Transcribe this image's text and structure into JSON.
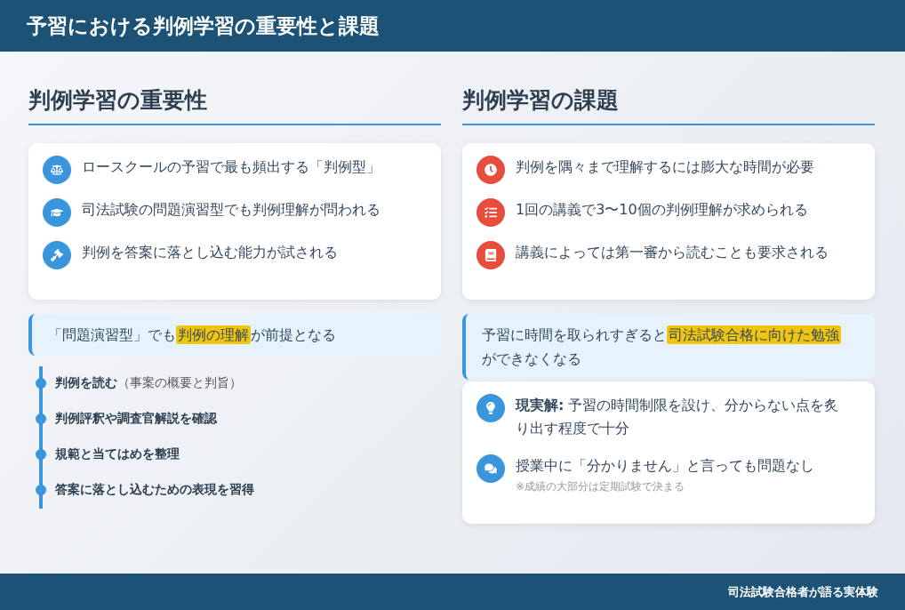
{
  "header": {
    "title": "予習における判例学習の重要性と課題"
  },
  "columns": [
    {
      "kind": "positive",
      "heading": "判例学習の重要性",
      "points": [
        {
          "text": "ロースクールの予習で最も頻出する「判例型」"
        },
        {
          "text": "司法試験の問題演習型でも判例理解が問われる"
        },
        {
          "text": "判例を答案に落とし込む能力が試される"
        }
      ],
      "callout": [
        {
          "text": "「問題演習型」でも",
          "highlight": false
        },
        {
          "text": "判例の理解",
          "highlight": true
        },
        {
          "text": "が前提となる",
          "highlight": false
        }
      ],
      "timeline": [
        {
          "title": "判例を読む",
          "note": "（事案の概要と判旨）"
        },
        {
          "title": "判例評釈や調査官解説を確認"
        },
        {
          "title": "規範と当てはめを整理"
        },
        {
          "title": "答案に落とし込むための表現を習得"
        }
      ]
    },
    {
      "kind": "negative",
      "heading": "判例学習の課題",
      "points": [
        {
          "text": "判例を隅々まで理解するには膨大な時間が必要"
        },
        {
          "text": "1回の講義で3〜10個の判例理解が求められる"
        },
        {
          "text": "講義によっては第一審から読むことも要求される"
        }
      ],
      "callout": [
        {
          "text": "予習に時間を取られすぎると",
          "highlight": false
        },
        {
          "text": "司法試験合格に向けた勉強",
          "highlight": true
        },
        {
          "text": "ができなくなる",
          "highlight": false
        }
      ],
      "solutions": [
        {
          "text": "**現実解:** 予習の時間制限を設け、分からない点を炙り出す程度で十分"
        },
        {
          "text": "授業中に「分かりません」と言っても問題なし",
          "note": "※成績の大部分は定期試験で決まる"
        }
      ]
    }
  ],
  "footer": {
    "text": "司法試験合格者が語る実体験"
  }
}
